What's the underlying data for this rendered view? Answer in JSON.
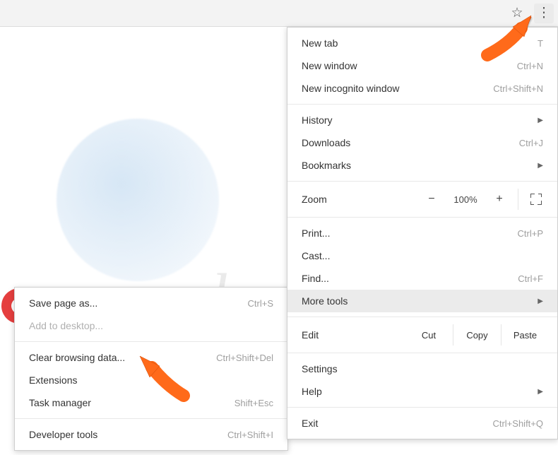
{
  "toolbar": {
    "star_icon": "☆",
    "kebab_icon": "⋮"
  },
  "menu": {
    "section1": [
      {
        "label": "New tab",
        "shortcut": "T"
      },
      {
        "label": "New window",
        "shortcut": "Ctrl+N"
      },
      {
        "label": "New incognito window",
        "shortcut": "Ctrl+Shift+N"
      }
    ],
    "section2": [
      {
        "label": "History",
        "arrow": true
      },
      {
        "label": "Downloads",
        "shortcut": "Ctrl+J"
      },
      {
        "label": "Bookmarks",
        "arrow": true
      }
    ],
    "zoom": {
      "label": "Zoom",
      "value": "100%"
    },
    "section4": [
      {
        "label": "Print...",
        "shortcut": "Ctrl+P"
      },
      {
        "label": "Cast..."
      },
      {
        "label": "Find...",
        "shortcut": "Ctrl+F"
      },
      {
        "label": "More tools",
        "arrow": true,
        "highlighted": true
      }
    ],
    "edit": {
      "label": "Edit",
      "cut": "Cut",
      "copy": "Copy",
      "paste": "Paste"
    },
    "section6": [
      {
        "label": "Settings"
      },
      {
        "label": "Help",
        "arrow": true
      }
    ],
    "section7": [
      {
        "label": "Exit",
        "shortcut": "Ctrl+Shift+Q"
      }
    ]
  },
  "submenu": {
    "section1": [
      {
        "label": "Save page as...",
        "shortcut": "Ctrl+S"
      },
      {
        "label": "Add to desktop...",
        "disabled": true
      }
    ],
    "section2": [
      {
        "label": "Clear browsing data...",
        "shortcut": "Ctrl+Shift+Del"
      },
      {
        "label": "Extensions"
      },
      {
        "label": "Task manager",
        "shortcut": "Shift+Esc"
      }
    ],
    "section3": [
      {
        "label": "Developer tools",
        "shortcut": "Ctrl+Shift+I"
      }
    ]
  },
  "watermark": {
    "text": "k.com"
  }
}
